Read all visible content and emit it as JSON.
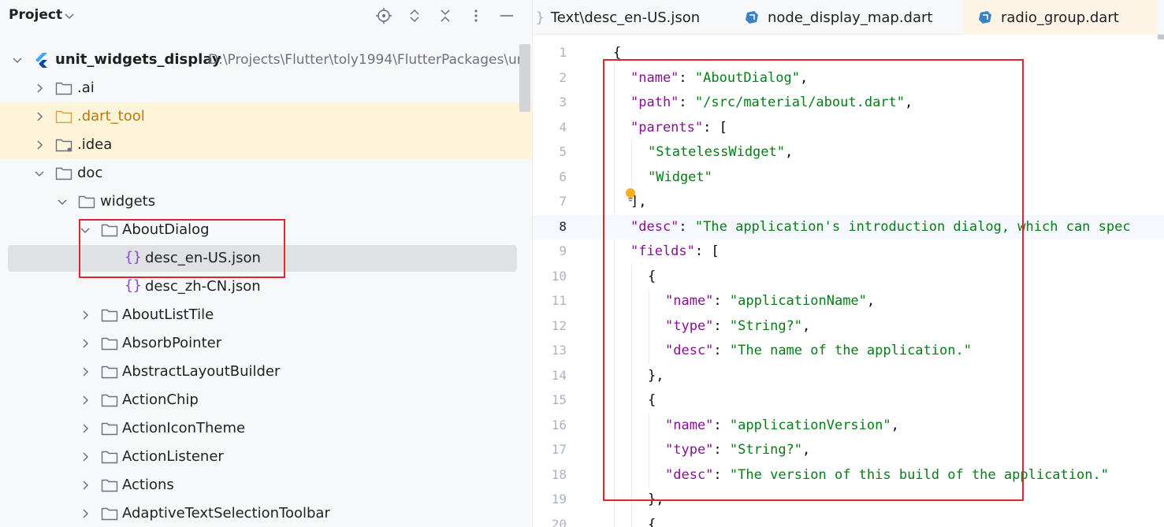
{
  "panel": {
    "title": "Project"
  },
  "tree": {
    "root_label": "unit_widgets_display",
    "root_path": "D:\\Projects\\Flutter\\toly1994\\FlutterPackages\\un",
    "rows": [
      {
        "label": ".ai"
      },
      {
        "label": ".dart_tool"
      },
      {
        "label": ".idea"
      },
      {
        "label": "doc"
      },
      {
        "label": "widgets"
      },
      {
        "label": "AboutDialog"
      },
      {
        "label": "desc_en-US.json"
      },
      {
        "label": "desc_zh-CN.json"
      },
      {
        "label": "AboutListTile"
      },
      {
        "label": "AbsorbPointer"
      },
      {
        "label": "AbstractLayoutBuilder"
      },
      {
        "label": "ActionChip"
      },
      {
        "label": "ActionIconTheme"
      },
      {
        "label": "ActionListener"
      },
      {
        "label": "Actions"
      },
      {
        "label": "AdaptiveTextSelectionToolbar"
      }
    ],
    "json_icon": "{}"
  },
  "tabs": [
    {
      "brace": "}",
      "label": "Text\\desc_en-US.json"
    },
    {
      "label": "node_display_map.dart"
    },
    {
      "label": "radio_group.dart"
    }
  ],
  "code": {
    "line_numbers": [
      "1",
      "2",
      "3",
      "4",
      "5",
      "6",
      "7",
      "8",
      "9",
      "10",
      "11",
      "12",
      "13",
      "14",
      "15",
      "16",
      "17",
      "18",
      "19",
      "20"
    ],
    "l1": "{",
    "l2k": "\"name\"",
    "l2s": "\"AboutDialog\"",
    "l3k": "\"path\"",
    "l3s": "\"/src/material/about.dart\"",
    "l4k": "\"parents\"",
    "l5s": "\"StatelessWidget\"",
    "l6s": "\"Widget\"",
    "l7": "],",
    "l8k": "\"desc\"",
    "l8s": "\"The application's introduction dialog, which can spec",
    "l9k": "\"fields\"",
    "l10": "{",
    "l11k": "\"name\"",
    "l11s": "\"applicationName\"",
    "l12k": "\"type\"",
    "l12s": "\"String?\"",
    "l13k": "\"desc\"",
    "l13s": "\"The name of the application.\"",
    "l14": "},",
    "l15": "{",
    "l16k": "\"name\"",
    "l16s": "\"applicationVersion\"",
    "l17k": "\"type\"",
    "l17s": "\"String?\"",
    "l18k": "\"desc\"",
    "l18s": "\"The version of this build of the application.\"",
    "l19": "},",
    "l20": "{",
    "colon": ": ",
    "comma": ",",
    "bracket_open": ": ["
  },
  "colors": {
    "highlight_box": "#e0252d",
    "json_key": "#871094",
    "json_string": "#067d17"
  },
  "icons": [
    "chevron-down-icon",
    "locate-icon",
    "expand-all-icon",
    "collapse-all-icon",
    "more-options-icon",
    "minimize-icon",
    "flutter-icon",
    "folder-icon",
    "chevron-right-icon",
    "json-file-icon",
    "dart-file-icon",
    "lightbulb-icon"
  ]
}
